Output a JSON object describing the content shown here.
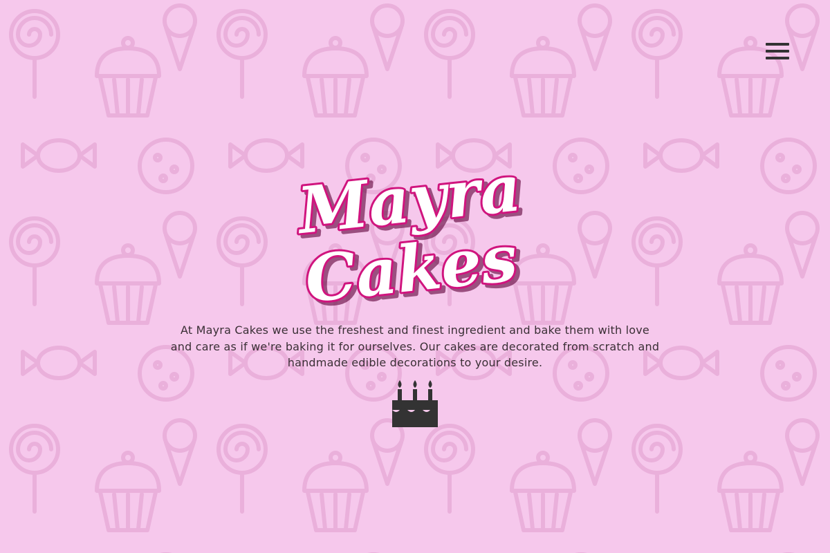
{
  "brand": {
    "line1": "Mayra",
    "line2": "Cakes"
  },
  "intro": {
    "lines": [
      "At Mayra Cakes we use the freshest and finest ingredient and bake them with love",
      "and care as if we're baking it for ourselves. Our cakes are decorated from scratch and",
      "handmade edible decorations to your desire."
    ]
  },
  "icons": {
    "menu": "hamburger-menu-icon",
    "cake": "birthday-cake-icon",
    "background": "sweets-pattern"
  },
  "colors": {
    "background": "#f6c8ec",
    "pattern": "#eab0db",
    "logo_fill": "#ffffff",
    "logo_stroke": "#d0147e",
    "text": "#3a2f35",
    "icon": "#333333"
  }
}
